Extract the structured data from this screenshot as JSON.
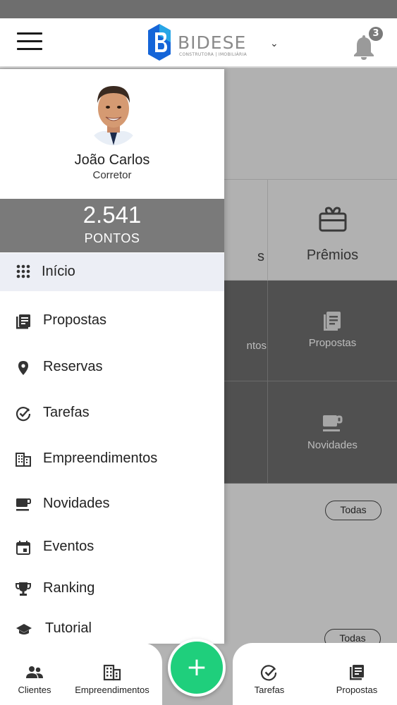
{
  "header": {
    "brand_name": "BIDESE",
    "brand_tagline": "CONSTRUTORA | IMOBILIÁRIA",
    "notification_count": "3",
    "colors": {
      "logo_blue": "#1565d8",
      "logo_cyan": "#27a6e6"
    }
  },
  "profile": {
    "name": "João Carlos",
    "role": "Corretor",
    "points_value": "2.541",
    "points_label": "PONTOS"
  },
  "menu": {
    "items": [
      {
        "label": "Início",
        "icon": "grid-icon",
        "active": true
      },
      {
        "label": "Propostas",
        "icon": "list-icon"
      },
      {
        "label": "Reservas",
        "icon": "location-pin-icon"
      },
      {
        "label": "Tarefas",
        "icon": "check-circle-icon"
      },
      {
        "label": "Empreendimentos",
        "icon": "building-icon"
      },
      {
        "label": "Novidades",
        "icon": "coffee-cup-icon"
      },
      {
        "label": "Eventos",
        "icon": "calendar-icon"
      },
      {
        "label": "Ranking",
        "icon": "trophy-icon"
      },
      {
        "label": "Tutorial",
        "icon": "graduation-cap-icon"
      }
    ]
  },
  "background": {
    "tile_fragment_1": "s",
    "tile_premios": "Prêmios",
    "tile_fragment_2": "ntos",
    "tile_propostas": "Propostas",
    "tile_novidades": "Novidades",
    "todas_1": "Todas",
    "todas_2": "Todas"
  },
  "bottom_nav": {
    "clientes": "Clientes",
    "empreendimentos": "Empreendimentos",
    "tarefas": "Tarefas",
    "propostas": "Propostas",
    "fab": "+"
  },
  "colors": {
    "fab": "#1fcf7c",
    "points_bar": "#7a7a7a",
    "active_item": "#eceef5"
  }
}
